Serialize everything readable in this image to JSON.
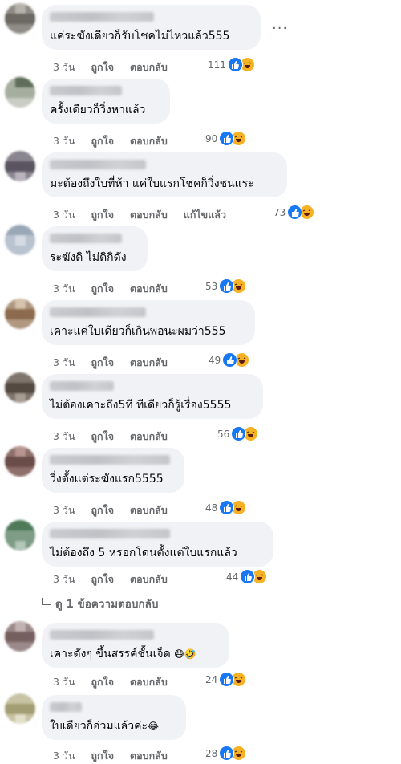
{
  "colors": {
    "bubble": "#f0f2f5",
    "meta": "#65676b",
    "like": "#1877f2",
    "haha": "#f7b125"
  },
  "comments": [
    {
      "text": "แค่ระฆังเดียวก็รับโชคไม่ไหวแล้ว555",
      "time": "3 วัน",
      "like": "ถูกใจ",
      "reply": "ตอบกลับ",
      "count": "111",
      "reacts": [
        "like-icon",
        "haha-icon"
      ]
    },
    {
      "text": "ครั้งเดียวก็วิ่งหาแล้ว",
      "time": "3 วัน",
      "like": "ถูกใจ",
      "reply": "ตอบกลับ",
      "count": "90",
      "reacts": [
        "like-icon",
        "haha-icon"
      ]
    },
    {
      "text": "มะต้องถึงใบที่ห้า แค่ใบแรกโชคก็วิ่งชนแระ",
      "time": "3 วัน",
      "like": "ถูกใจ",
      "reply": "ตอบกลับ",
      "edited": "แก้ไขแล้ว",
      "count": "73",
      "reacts": [
        "like-icon",
        "haha-icon"
      ]
    },
    {
      "text": "ระฆังดิ ไม่ดิกิดัง",
      "time": "3 วัน",
      "like": "ถูกใจ",
      "reply": "ตอบกลับ",
      "count": "53",
      "reacts": [
        "like-icon",
        "haha-icon"
      ]
    },
    {
      "text": "เคาะแค่ใบเดียวก็เกินพอนะผมว่า555",
      "time": "3 วัน",
      "like": "ถูกใจ",
      "reply": "ตอบกลับ",
      "count": "49",
      "reacts": [
        "like-icon",
        "haha-icon"
      ]
    },
    {
      "text": "ไม่ต้องเคาะถึง5ที ทีเดียวก็รู้เรื่อง5555",
      "time": "3 วัน",
      "like": "ถูกใจ",
      "reply": "ตอบกลับ",
      "count": "56",
      "reacts": [
        "like-icon",
        "haha-icon"
      ]
    },
    {
      "text": "วิ่งตั้งแต่ระฆังแรก5555",
      "time": "3 วัน",
      "like": "ถูกใจ",
      "reply": "ตอบกลับ",
      "count": "48",
      "reacts": [
        "like-icon",
        "haha-icon"
      ]
    },
    {
      "text": "ไม่ต้องถึง 5 หรอกโดนตั้งแต่ใบแรกแล้ว",
      "time": "3 วัน",
      "like": "ถูกใจ",
      "reply": "ตอบกลับ",
      "count": "44",
      "reacts": [
        "like-icon",
        "haha-icon"
      ]
    },
    {
      "text": "เคาะดังๆ ขึ้นสรรค์ชั้นเจ็ด",
      "emoji": "😷🤣",
      "time": "3 วัน",
      "like": "ถูกใจ",
      "reply": "ตอบกลับ",
      "count": "24",
      "reacts": [
        "like-icon",
        "haha-icon"
      ]
    },
    {
      "text": "ใบเดียวก็อ่วมแล้วค่ะ",
      "emoji": "😂",
      "time": "3 วัน",
      "like": "ถูกใจ",
      "reply": "ตอบกลับ",
      "count": "28",
      "reacts": [
        "like-icon",
        "haha-icon"
      ]
    }
  ],
  "view_replies": "ดู 1 ข้อความตอบกลับ",
  "more_label": "···"
}
